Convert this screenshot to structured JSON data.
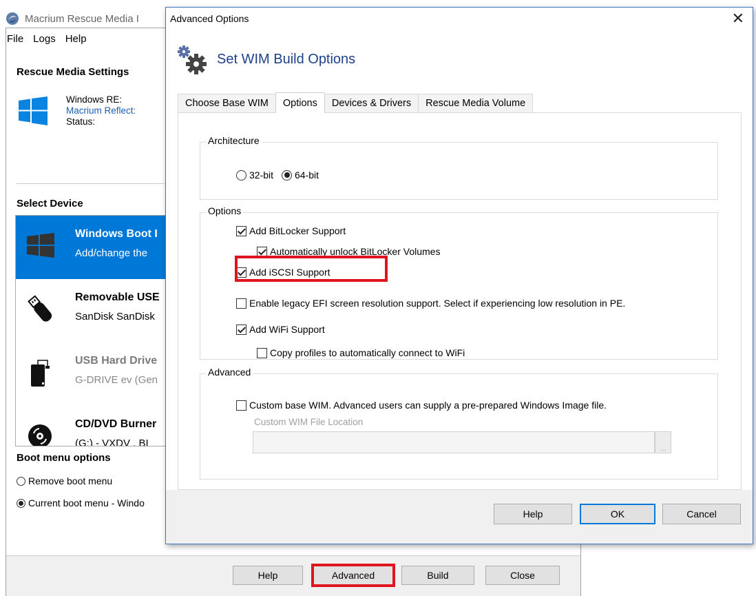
{
  "background_window": {
    "title": "Macrium Rescue Media I",
    "menu": [
      "File",
      "Logs",
      "Help"
    ],
    "rescue_media_settings": {
      "title": "Rescue Media Settings",
      "windows_re_label": "Windows RE:",
      "macrium_reflect_label": "Macrium Reflect:",
      "status_label": "Status:"
    },
    "select_device": {
      "title": "Select Device",
      "devices": [
        {
          "name": "Windows Boot I",
          "desc": "Add/change the",
          "icon": "windows-logo-icon",
          "selected": true
        },
        {
          "name": "Removable USE",
          "desc": "SanDisk SanDisk",
          "icon": "usb-stick-icon",
          "selected": false
        },
        {
          "name": "USB Hard Drive",
          "desc": "G-DRIVE ev (Gen",
          "icon": "external-drive-icon",
          "selected": false
        },
        {
          "name": "CD/DVD Burner",
          "desc": "(G:) - VXDV    , BI",
          "icon": "disc-icon",
          "selected": false
        }
      ]
    },
    "boot_menu": {
      "title": "Boot menu options",
      "remove_label": "Remove boot menu",
      "current_label": "Current boot menu - Windo",
      "selected": "current"
    },
    "footer_buttons": {
      "help": "Help",
      "advanced": "Advanced",
      "build": "Build",
      "close": "Close"
    }
  },
  "dialog": {
    "title": "Advanced Options",
    "close_glyph": "✕",
    "header": "Set WIM Build Options",
    "tabs": [
      "Choose Base WIM",
      "Options",
      "Devices & Drivers",
      "Rescue Media Volume"
    ],
    "active_tab": 1,
    "architecture": {
      "label": "Architecture",
      "option_32": "32-bit",
      "option_64": "64-bit",
      "selected": "64-bit"
    },
    "options": {
      "label": "Options",
      "bitlocker": {
        "label": "Add BitLocker Support",
        "checked": true
      },
      "auto_unlock": {
        "label": "Automatically unlock BitLocker Volumes",
        "checked": true
      },
      "iscsi": {
        "label": "Add iSCSI Support",
        "checked": true
      },
      "legacy_efi": {
        "label": "Enable legacy EFI screen resolution support.  Select if experiencing low resolution in PE.",
        "checked": false
      },
      "wifi": {
        "label": "Add WiFi Support",
        "checked": true
      },
      "wifi_profiles": {
        "label": "Copy profiles to automatically connect to WiFi",
        "checked": false
      }
    },
    "advanced": {
      "label": "Advanced",
      "custom_wim": {
        "label": "Custom base WIM. Advanced users can supply a pre-prepared Windows Image file.",
        "checked": false
      },
      "wim_location_label": "Custom WIM File Location",
      "wim_location_value": "",
      "browse_label": "..."
    },
    "buttons": {
      "help": "Help",
      "ok": "OK",
      "cancel": "Cancel"
    }
  },
  "colors": {
    "accent": "#0078d7",
    "highlight": "#e0141e",
    "header_text": "#1f3f8a",
    "link_text": "#1a5fb4"
  }
}
